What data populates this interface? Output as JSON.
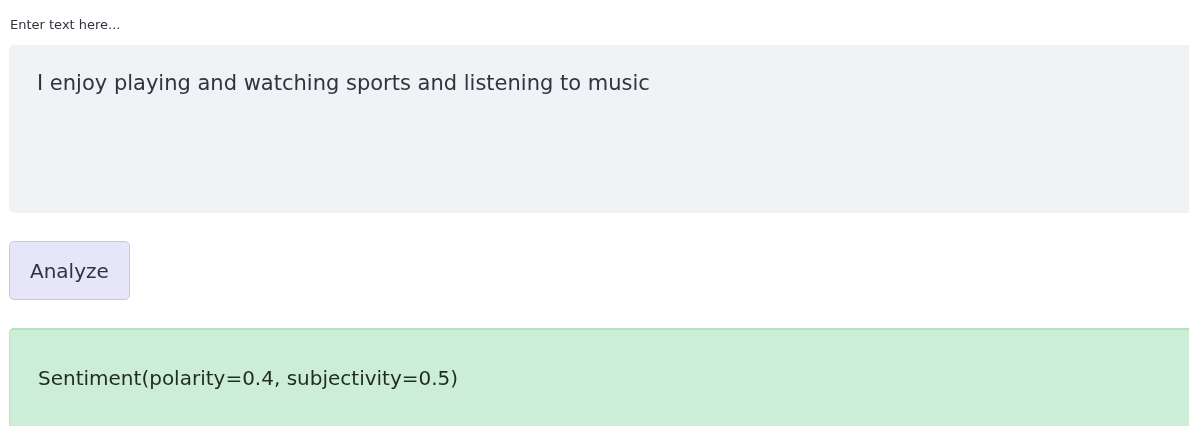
{
  "input": {
    "label": "Enter text here...",
    "value": "I enjoy playing and watching sports and listening to music"
  },
  "button": {
    "label": "Analyze"
  },
  "result": {
    "kind": "success",
    "text": "Sentiment(polarity=0.4, subjectivity=0.5)"
  }
}
